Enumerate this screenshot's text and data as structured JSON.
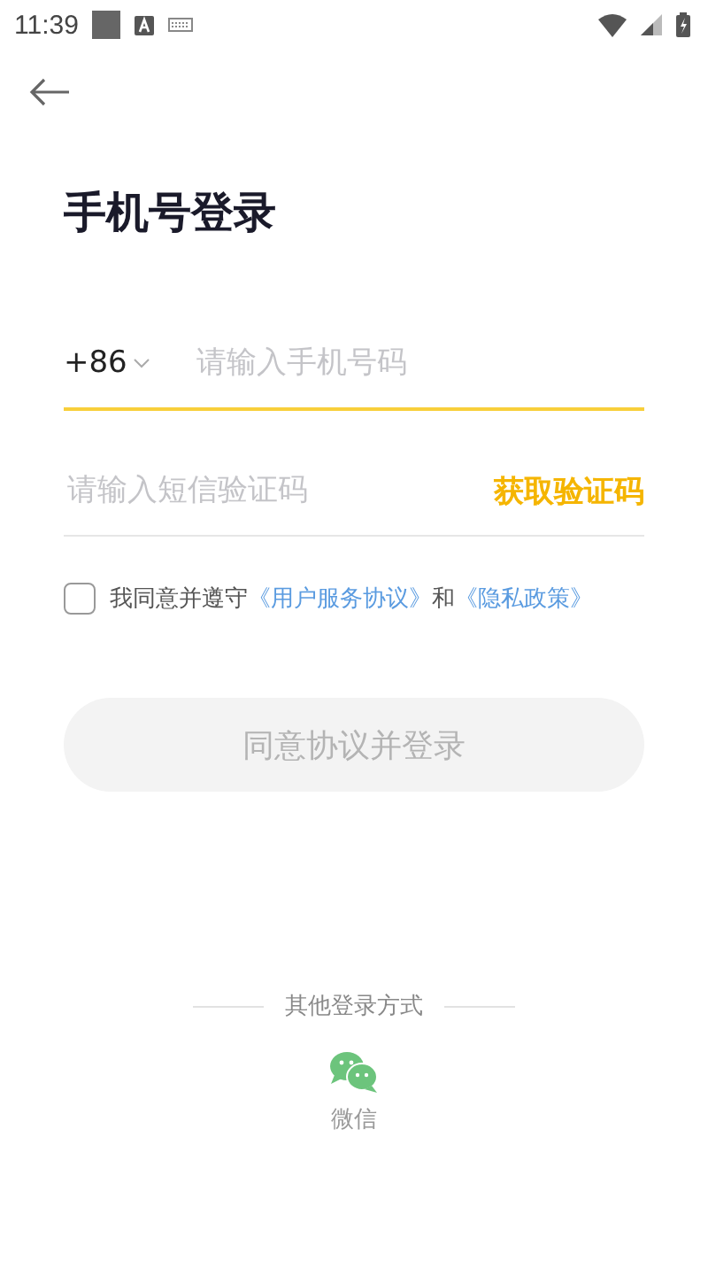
{
  "status_bar": {
    "time": "11:39"
  },
  "title": "手机号登录",
  "phone": {
    "country_code": "+86",
    "placeholder": "请输入手机号码",
    "focused": true
  },
  "code": {
    "placeholder": "请输入短信验证码",
    "get_code": "获取验证码"
  },
  "agreement": {
    "checked": false,
    "parts": [
      {
        "kind": "text",
        "text": "我同意并遵守"
      },
      {
        "kind": "link",
        "text": "《用户服务协议》"
      },
      {
        "kind": "text",
        "text": "和"
      },
      {
        "kind": "link",
        "text": "《隐私政策》"
      }
    ]
  },
  "login_button": {
    "label": "同意协议并登录",
    "disabled": true
  },
  "other_login": {
    "heading": "其他登录方式",
    "options": [
      {
        "label": "微信"
      }
    ]
  }
}
